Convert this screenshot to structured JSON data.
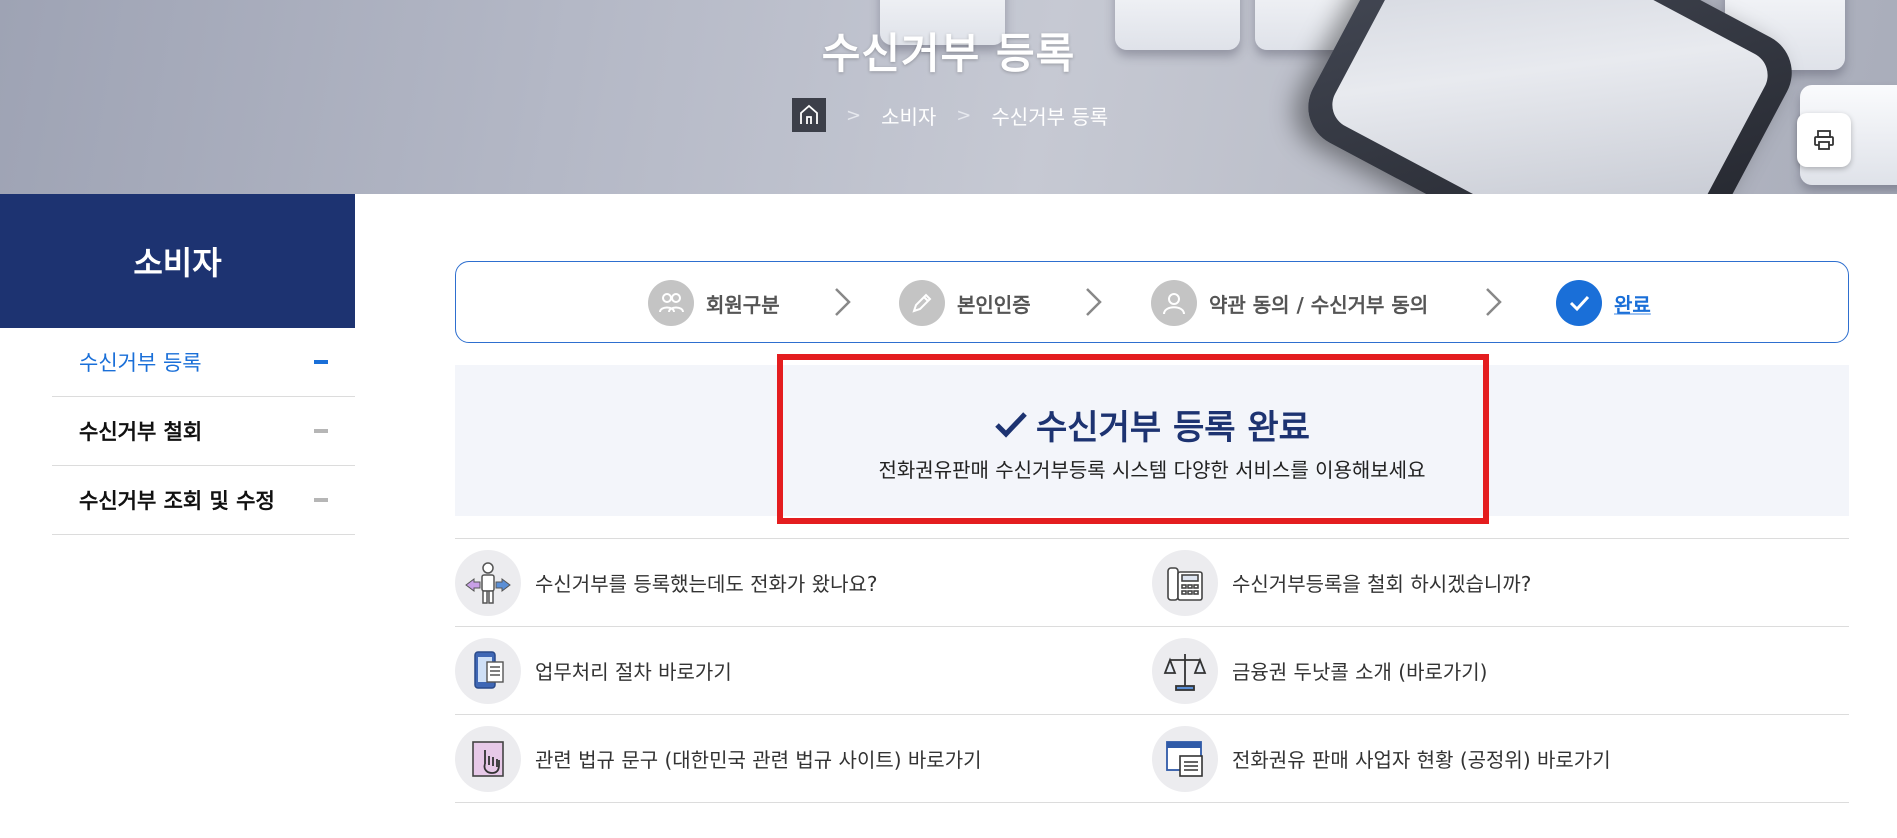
{
  "banner": {
    "title": "수신거부 등록",
    "breadcrumb": {
      "level1": "소비자",
      "level2": "수신거부 등록",
      "separator": ">"
    }
  },
  "sidebar": {
    "heading": "소비자",
    "items": [
      {
        "label": "수신거부 등록",
        "active": true
      },
      {
        "label": "수신거부 철회",
        "active": false
      },
      {
        "label": "수신거부 조회 및 수정",
        "active": false
      }
    ]
  },
  "steps": [
    {
      "label": "회원구분",
      "icon": "users-icon"
    },
    {
      "label": "본인인증",
      "icon": "pencil-icon"
    },
    {
      "label": "약관 동의 / 수신거부 동의",
      "icon": "user-icon"
    },
    {
      "label": "완료",
      "icon": "check-icon",
      "current": true
    }
  ],
  "complete": {
    "title": "수신거부 등록 완료",
    "subtitle": "전화권유판매 수신거부등록 시스템 다양한 서비스를 이용해보세요"
  },
  "links": [
    {
      "label": "수신거부를 등록했는데도 전화가 왔나요?",
      "icon": "person-arrows-icon"
    },
    {
      "label": "수신거부등록을 철회 하시겠습니까?",
      "icon": "fax-phone-icon"
    },
    {
      "label": "업무처리 절차 바로가기",
      "icon": "mobile-document-icon"
    },
    {
      "label": "금융권 두낫콜 소개 (바로가기)",
      "icon": "scales-icon"
    },
    {
      "label": "관련 법규 문구 (대한민국 관련 법규 사이트) 바로가기",
      "icon": "hand-pointer-icon"
    },
    {
      "label": "전화권유 판매 사업자 현황 (공정위) 바로가기",
      "icon": "browser-list-icon"
    }
  ],
  "colors": {
    "navy": "#1d3371",
    "accent_blue": "#1a6fd8",
    "highlight_red": "#e41d1f"
  }
}
